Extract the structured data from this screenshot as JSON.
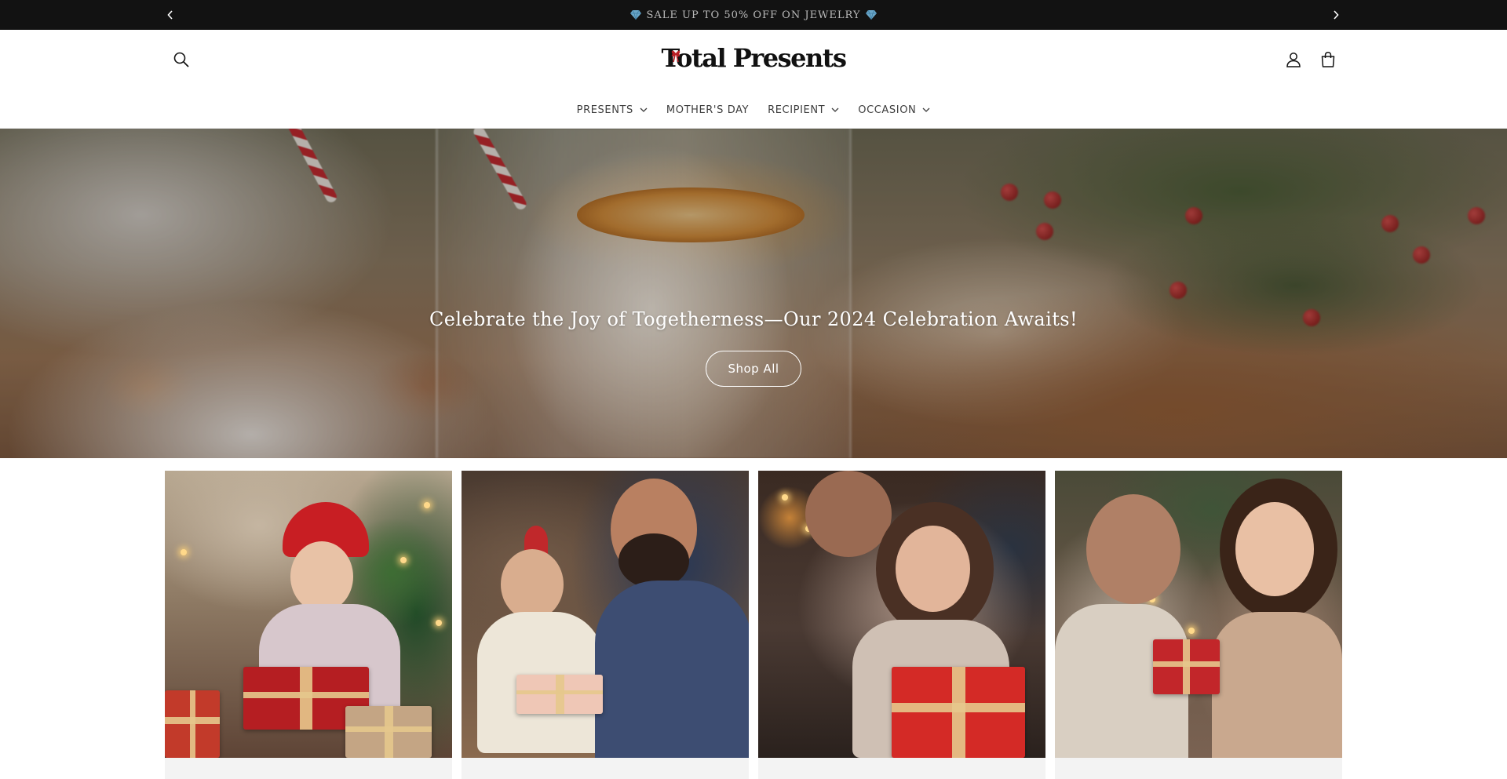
{
  "announcement": {
    "text": "SALE UP TO 50% OFF ON JEWELRY",
    "prev_icon": "chevron-left-icon",
    "next_icon": "chevron-right-icon"
  },
  "header": {
    "logo_text": "Total Presents",
    "nav": [
      {
        "label": "PRESENTS",
        "has_dropdown": true
      },
      {
        "label": "MOTHER'S DAY",
        "has_dropdown": false
      },
      {
        "label": "RECIPIENT",
        "has_dropdown": true
      },
      {
        "label": "OCCASION",
        "has_dropdown": true
      }
    ],
    "icons": [
      "search-icon",
      "account-icon",
      "cart-icon"
    ]
  },
  "hero": {
    "title": "Celebrate the Joy of Togetherness—Our 2024 Celebration Awaits!",
    "button_label": "Shop All"
  },
  "cards": [
    {
      "image": "child-santa-hat-receiving-gift"
    },
    {
      "image": "father-daughter-unwrapping-gift"
    },
    {
      "image": "couple-opening-red-gift"
    },
    {
      "image": "couple-smiling-holding-gift"
    }
  ],
  "colors": {
    "announcement_bg": "#121212",
    "announcement_text": "#b9b9b9",
    "nav_text": "#3d3d3d",
    "card_bg": "#f3f3f3"
  }
}
